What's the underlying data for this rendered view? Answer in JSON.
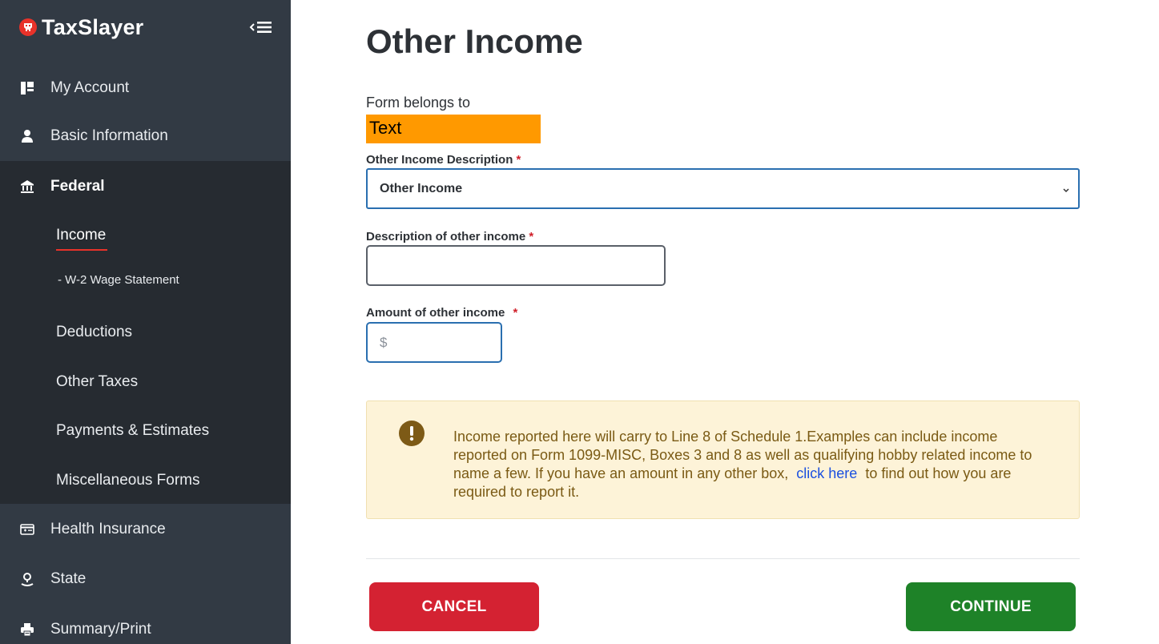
{
  "app": {
    "brand": "TaxSlayer"
  },
  "sidebar": {
    "items": [
      {
        "label": "My Account",
        "icon": "account-icon"
      },
      {
        "label": "Basic Information",
        "icon": "person-icon"
      },
      {
        "label": "Federal",
        "icon": "bank-icon"
      },
      {
        "label": "Health Insurance",
        "icon": "health-card-icon"
      },
      {
        "label": "State",
        "icon": "location-icon"
      },
      {
        "label": "Summary/Print",
        "icon": "printer-icon"
      }
    ],
    "federal_sub": {
      "income": "Income",
      "w2": "- W-2 Wage Statement",
      "deductions": "Deductions",
      "other_taxes": "Other Taxes",
      "payments": "Payments & Estimates",
      "misc": "Miscellaneous Forms"
    }
  },
  "main": {
    "title": "Other Income",
    "form_belongs_label": "Form belongs to",
    "form_belongs_value": "Text",
    "required_mark": "*",
    "other_income_desc": {
      "label": "Other Income Description",
      "selected": "Other Income"
    },
    "desc_of_other_income": {
      "label": "Description of other income",
      "value": ""
    },
    "amount_of_other_income": {
      "label": "Amount of other income",
      "placeholder": "$"
    },
    "notice": {
      "text_before": "Income reported here will carry to Line 8 of Schedule 1.Examples can include income reported on Form 1099-MISC, Boxes 3 and 8 as well as qualifying hobby related income to name a few. If you have an amount in any other box,",
      "link": "click here",
      "text_after": "to find out how you are required to report it."
    },
    "buttons": {
      "cancel": "CANCEL",
      "continue": "CONTINUE"
    }
  },
  "colors": {
    "sidebar_bg": "#323a44",
    "federal_bg": "#262b31",
    "brand_red": "#e8322a",
    "cancel_red": "#d42232",
    "continue_green": "#1e8228",
    "focus_blue": "#2a6fb0",
    "notice_bg": "#fdf3d8",
    "highlight_orange": "#ff9900"
  }
}
